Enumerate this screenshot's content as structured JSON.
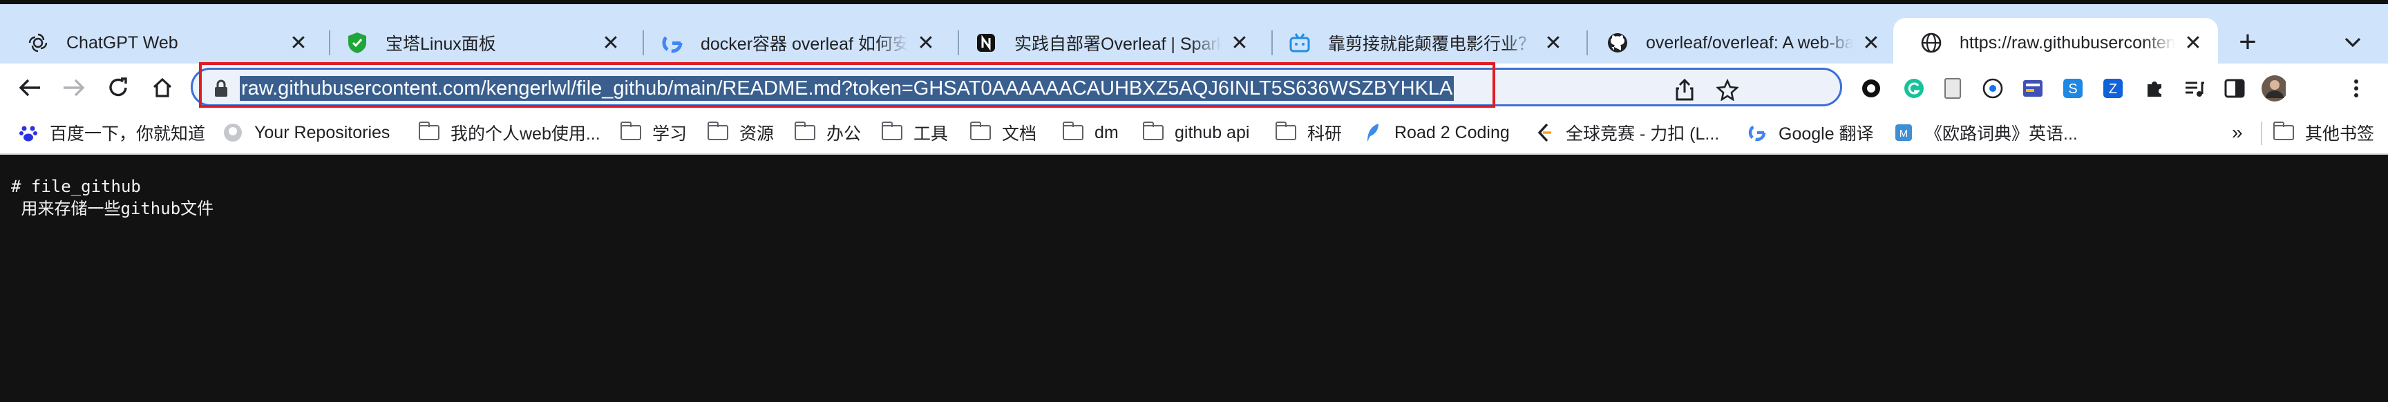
{
  "tabs": [
    {
      "title": "ChatGPT Web",
      "icon": "openai-icon",
      "active": false
    },
    {
      "title": "宝塔Linux面板",
      "icon": "baota-shield-icon",
      "active": false
    },
    {
      "title": "docker容器 overleaf 如何安装",
      "icon": "google-icon",
      "active": false
    },
    {
      "title": "实践自部署Overleaf | Sparkto",
      "icon": "notion-icon",
      "active": false
    },
    {
      "title": "靠剪接就能颠覆电影行业？！剪",
      "icon": "bilibili-icon",
      "active": false
    },
    {
      "title": "overleaf/overleaf: A web-bas",
      "icon": "github-icon",
      "active": false
    },
    {
      "title": "https://raw.githubuserconten",
      "icon": "globe-icon",
      "active": true
    }
  ],
  "address_bar": {
    "url": "raw.githubusercontent.com/kengerlwl/file_github/main/README.md?token=GHSAT0AAAAAACAUHBXZ5AQJ6INLT5S636WSZBYHKLA",
    "highlight_color": "#e11b22"
  },
  "bookmarks": [
    {
      "label": "百度一下，你就知道",
      "icon": "baidu-paw-icon"
    },
    {
      "label": "Your Repositories",
      "icon": "github-icon"
    },
    {
      "label": "我的个人web使用...",
      "icon": "folder-icon"
    },
    {
      "label": "学习",
      "icon": "folder-icon"
    },
    {
      "label": "资源",
      "icon": "folder-icon"
    },
    {
      "label": "办公",
      "icon": "folder-icon"
    },
    {
      "label": "工具",
      "icon": "folder-icon"
    },
    {
      "label": "文档",
      "icon": "folder-icon"
    },
    {
      "label": "dm",
      "icon": "folder-icon"
    },
    {
      "label": "github api",
      "icon": "folder-icon"
    },
    {
      "label": "科研",
      "icon": "folder-icon"
    },
    {
      "label": "Road 2 Coding",
      "icon": "feather-icon"
    },
    {
      "label": "全球竞赛 - 力扣 (L...",
      "icon": "leetcode-icon"
    },
    {
      "label": "Google 翻译",
      "icon": "google-icon"
    },
    {
      "label": "《欧路词典》英语...",
      "icon": "eudic-icon"
    }
  ],
  "bookmarks_more": "»",
  "other_bookmarks": "其他书签",
  "page_content": {
    "line1": "# file_github",
    "line2": " 用来存储一些github文件"
  }
}
